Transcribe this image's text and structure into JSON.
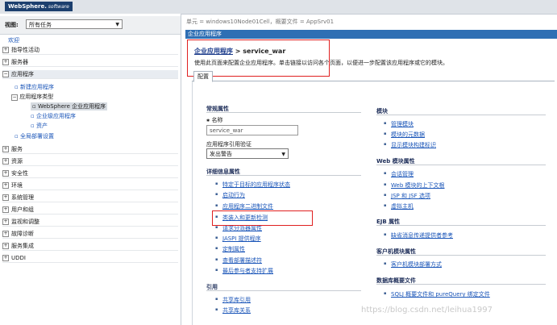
{
  "header": {
    "brand_bold": "WebSphere.",
    "brand_rest": " software"
  },
  "nav": {
    "view_label": "视图:",
    "view_value": "所有任务",
    "welcome": "欢迎",
    "groups_top": [
      "指导性活动",
      "服务器"
    ],
    "apps_group": "应用程序",
    "apps_new": "新建应用程序",
    "apps_types": "应用程序类型",
    "apps_types_children": [
      "WebSphere 企业应用程序",
      "企业级应用程序",
      "资产"
    ],
    "apps_global": "全局部署设置",
    "groups_bottom": [
      "服务",
      "资源",
      "安全性",
      "环境",
      "系统管理",
      "用户和组",
      "监视和调整",
      "故障诊断",
      "服务集成",
      "UDDI"
    ]
  },
  "breadcrumb": "单元 = windows10Node01Cell，概要文件 = AppSrv01",
  "band_title": "企业应用程序",
  "title": {
    "link": "企业应用程序",
    "rest": " > service_war"
  },
  "description": "使用此页面来配置企业应用程序。单击链接以访问各个页面，以便进一步配置该应用程序或它的模块。",
  "tab_label": "配置",
  "general": {
    "heading": "常规属性",
    "name_label": "名称",
    "name_value": "service_war",
    "validation_label": "应用程序引用验证",
    "validation_value": "发出警告"
  },
  "detail": {
    "heading": "详细信息属性",
    "links": [
      "特定于目标的应用程序状态",
      "启动行为",
      "应用程序二进制文件",
      "类装入和更新检测",
      "请求分派器属性",
      "JASPI 提供程序",
      "定制属性",
      "查看部署描述符",
      "最后参与者支持扩展"
    ]
  },
  "references": {
    "heading": "引用",
    "links": [
      "共享库引用",
      "共享库关系"
    ]
  },
  "modules": {
    "heading": "模块",
    "links": [
      "管理模块",
      "模块的元数据",
      "显示模块构建标识"
    ]
  },
  "web_module": {
    "heading": "Web 模块属性",
    "links": [
      "会话管理",
      "Web 模块的上下文根",
      "JSP 和 JSF 选项",
      "虚拟主机"
    ]
  },
  "ejb": {
    "heading": "EJB 属性",
    "links": [
      "缺省消息传递提供者参考"
    ]
  },
  "client": {
    "heading": "客户机模块属性",
    "links": [
      "客户机模块部署方式"
    ]
  },
  "database": {
    "heading": "数据库概要文件",
    "links": [
      "SQLJ 概要文件和 pureQuery 绑定文件"
    ]
  },
  "watermark": "https://blog.csdn.net/leihua1997",
  "colors": {
    "band": "#2f6fb4",
    "highlight": "#e02020",
    "link": "#1a55b8"
  }
}
